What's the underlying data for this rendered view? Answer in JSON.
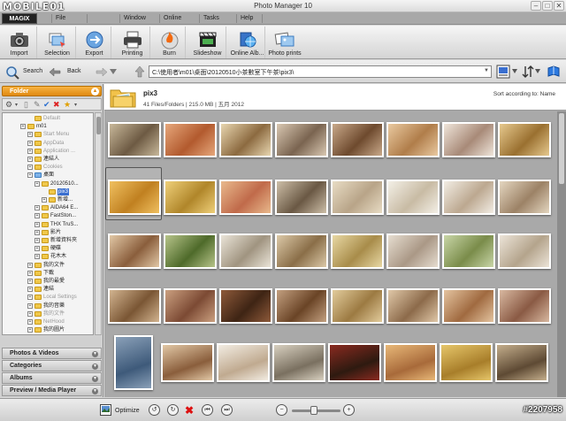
{
  "window": {
    "logo": "MOBILE01",
    "title": "Photo Manager 10",
    "controls": [
      "minimize",
      "maximize",
      "close"
    ]
  },
  "menu": {
    "brand": "MAGIX",
    "items": [
      "File",
      "",
      "Window",
      "Online",
      "Tasks",
      "Help",
      ""
    ]
  },
  "ribbon": {
    "buttons": [
      {
        "label": "Import",
        "icon": "camera-icon"
      },
      {
        "label": "Selection",
        "icon": "selection-icon"
      },
      {
        "label": "Export",
        "icon": "export-icon"
      },
      {
        "label": "Printing",
        "icon": "printer-icon"
      },
      {
        "label": "Burn",
        "icon": "burn-disc-icon"
      },
      {
        "label": "Slideshow",
        "icon": "clapper-icon"
      },
      {
        "label": "Online Alb...",
        "icon": "globe-icon"
      },
      {
        "label": "Photo prints",
        "icon": "photo-prints-icon"
      }
    ]
  },
  "nav": {
    "search": "Search",
    "back": "Back",
    "path": "C:\\使用者\\m01\\桌面\\20120510小茶數室下午茶\\pix3\\"
  },
  "left": {
    "folder_header": "Folder",
    "tree": [
      {
        "label": "Default",
        "dim": true,
        "indent": 3,
        "exp": false
      },
      {
        "label": "m01",
        "dim": false,
        "indent": 2,
        "exp": true
      },
      {
        "label": "Start Menu",
        "dim": true,
        "indent": 3,
        "exp": true
      },
      {
        "label": "AppData",
        "dim": true,
        "indent": 3,
        "exp": true
      },
      {
        "label": "Application ...",
        "dim": true,
        "indent": 3,
        "exp": true
      },
      {
        "label": "連結人",
        "dim": false,
        "indent": 3,
        "exp": true
      },
      {
        "label": "Cookies",
        "dim": true,
        "indent": 3,
        "exp": true
      },
      {
        "label": "桌面",
        "dim": false,
        "indent": 3,
        "exp": true,
        "blue": true
      },
      {
        "label": "20120510...",
        "dim": false,
        "indent": 4,
        "exp": true
      },
      {
        "label": "pix3",
        "dim": false,
        "indent": 5,
        "exp": false,
        "selected": true
      },
      {
        "label": "新增...",
        "dim": false,
        "indent": 5,
        "exp": true
      },
      {
        "label": "AIDA64 E...",
        "dim": false,
        "indent": 4,
        "exp": true
      },
      {
        "label": "FastSton...",
        "dim": false,
        "indent": 4,
        "exp": true
      },
      {
        "label": "THX TruS...",
        "dim": false,
        "indent": 4,
        "exp": true
      },
      {
        "label": "影片",
        "dim": false,
        "indent": 4,
        "exp": true
      },
      {
        "label": "新增資料夾",
        "dim": false,
        "indent": 4,
        "exp": true
      },
      {
        "label": "硬碟",
        "dim": false,
        "indent": 4,
        "exp": true
      },
      {
        "label": "花木木",
        "dim": false,
        "indent": 4,
        "exp": true
      },
      {
        "label": "我的文件",
        "dim": false,
        "indent": 3,
        "exp": true
      },
      {
        "label": "下載",
        "dim": false,
        "indent": 3,
        "exp": true
      },
      {
        "label": "我的最愛",
        "dim": false,
        "indent": 3,
        "exp": true
      },
      {
        "label": "連結",
        "dim": false,
        "indent": 3,
        "exp": true
      },
      {
        "label": "Local Settings",
        "dim": true,
        "indent": 3,
        "exp": true
      },
      {
        "label": "我的音樂",
        "dim": false,
        "indent": 3,
        "exp": true
      },
      {
        "label": "我的文件",
        "dim": true,
        "indent": 3,
        "exp": true
      },
      {
        "label": "NetHood",
        "dim": true,
        "indent": 3,
        "exp": true
      },
      {
        "label": "我的圖片",
        "dim": false,
        "indent": 3,
        "exp": true
      }
    ],
    "sections": [
      "Photos & Videos",
      "Categories",
      "Albums",
      "Preview / Media Player"
    ]
  },
  "main": {
    "folder_name": "pix3",
    "folder_info": "41 Files/Folders | 215.0 MB | 五月 2012",
    "sort": "Sort according to: Name"
  },
  "bottom": {
    "optimize": "Optimize",
    "watermark": "#2207958",
    "zoom": 0.45
  },
  "colors": {
    "accent": "#f0a020",
    "selection": "#3a6fd0"
  }
}
